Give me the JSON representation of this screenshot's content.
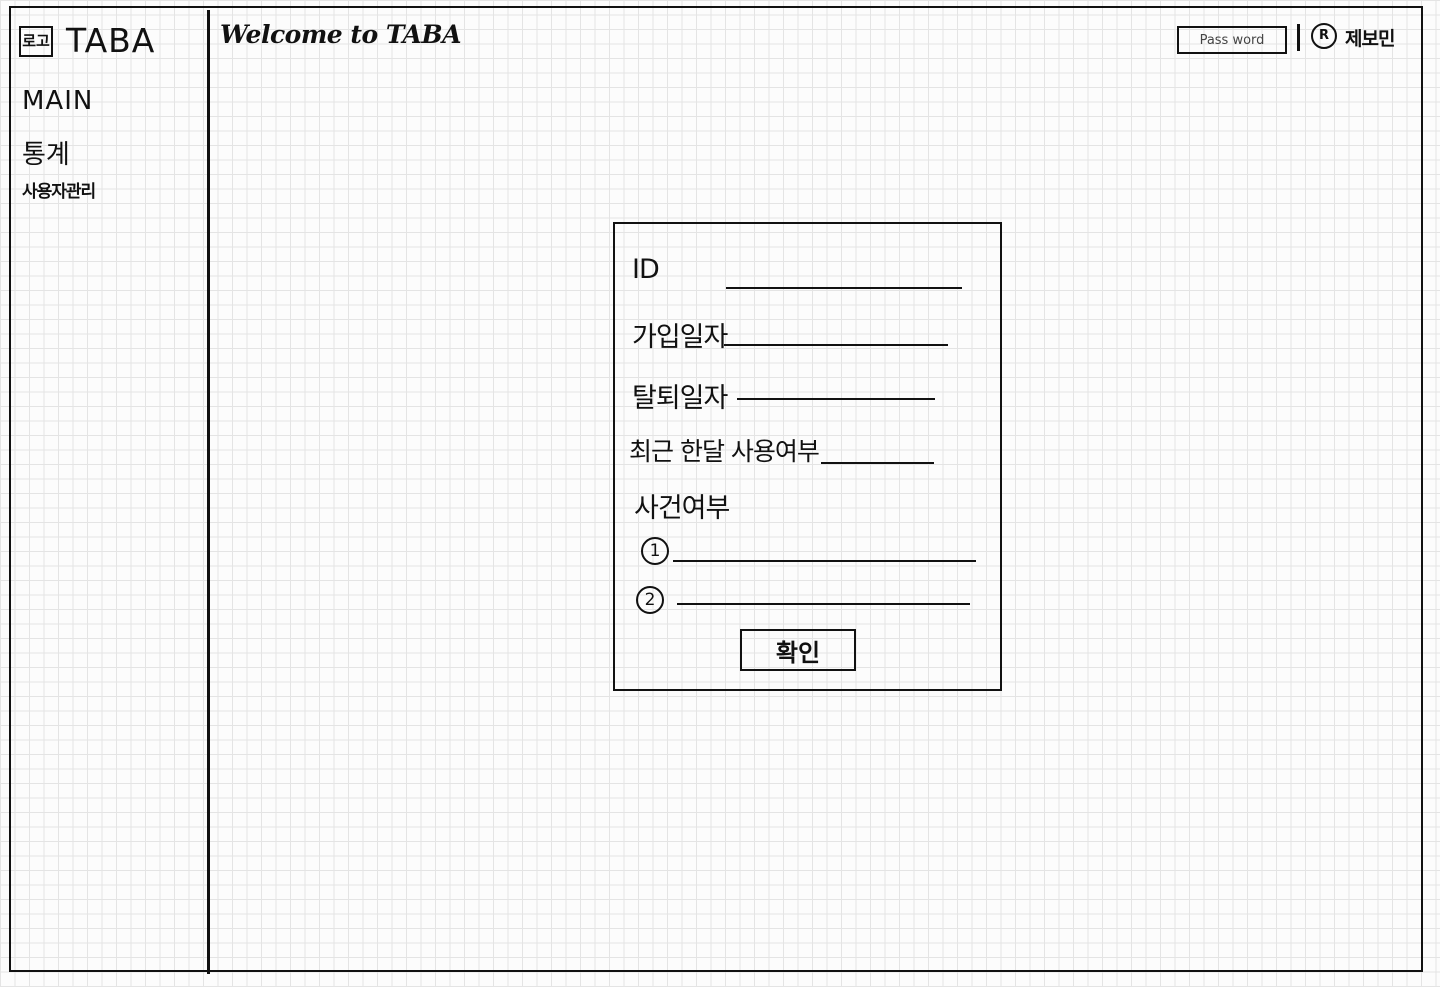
{
  "sidebar": {
    "logo_label": "로고",
    "brand": "TABA",
    "nav": [
      {
        "label": "MAIN"
      },
      {
        "label": "통계"
      },
      {
        "label": "사용자관리"
      }
    ]
  },
  "header": {
    "welcome": "Welcome to TABA",
    "password_placeholder": "Pass word",
    "user_icon_letter": "R",
    "user_name": "제보민"
  },
  "form": {
    "fields": [
      {
        "label": "ID"
      },
      {
        "label": "가입일자"
      },
      {
        "label": "탈퇴일자"
      },
      {
        "label": "최근 한달 사용여부"
      }
    ],
    "incident_label": "사건여부",
    "incident_items": [
      {
        "marker": "1"
      },
      {
        "marker": "2"
      }
    ],
    "confirm_label": "확인"
  }
}
